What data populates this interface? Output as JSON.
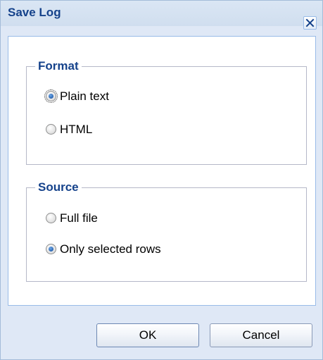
{
  "window": {
    "title": "Save Log",
    "close_icon": "close-icon"
  },
  "format": {
    "legend": "Format",
    "options": [
      {
        "label": "Plain text",
        "checked": true
      },
      {
        "label": "HTML",
        "checked": false
      }
    ]
  },
  "source": {
    "legend": "Source",
    "options": [
      {
        "label": "Full file",
        "checked": false
      },
      {
        "label": "Only selected rows",
        "checked": true
      }
    ]
  },
  "buttons": {
    "ok_label": "OK",
    "cancel_label": "Cancel"
  },
  "colors": {
    "title_text": "#15428b",
    "dialog_background": "#dfe8f6",
    "panel_border": "#99bbe8"
  }
}
